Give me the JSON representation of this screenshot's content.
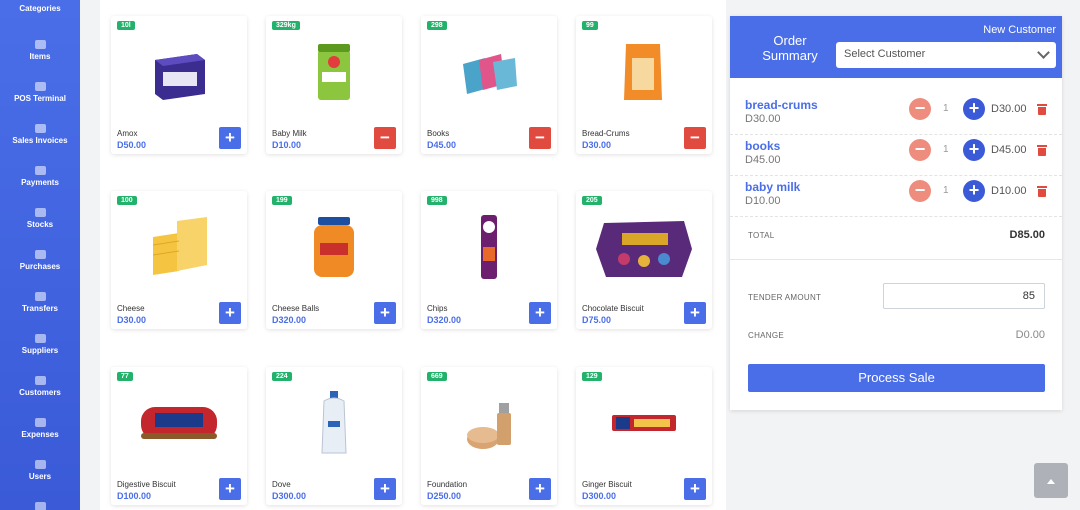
{
  "sidebar": {
    "items": [
      {
        "label": "Categories",
        "icon": "tag-icon"
      },
      {
        "label": "Items",
        "icon": "sitemap-icon"
      },
      {
        "label": "POS Terminal",
        "icon": "cash-register-icon"
      },
      {
        "label": "Sales Invoices",
        "icon": "file-icon"
      },
      {
        "label": "Payments",
        "icon": "money-icon"
      },
      {
        "label": "Stocks",
        "icon": "box-icon"
      },
      {
        "label": "Purchases",
        "icon": "cart-icon"
      },
      {
        "label": "Transfers",
        "icon": "truck-icon"
      },
      {
        "label": "Suppliers",
        "icon": "id-card-icon"
      },
      {
        "label": "Customers",
        "icon": "users-icon"
      },
      {
        "label": "Expenses",
        "icon": "wallet-icon"
      },
      {
        "label": "Users",
        "icon": "user-group-icon"
      }
    ]
  },
  "products": [
    {
      "stock": "10l",
      "name": "Amox",
      "price": "D50.00",
      "action": "add"
    },
    {
      "stock": "329kg",
      "name": "Baby Milk",
      "price": "D10.00",
      "action": "remove"
    },
    {
      "stock": "298",
      "name": "Books",
      "price": "D45.00",
      "action": "remove"
    },
    {
      "stock": "99",
      "name": "Bread-Crums",
      "price": "D30.00",
      "action": "remove"
    },
    {
      "stock": "100",
      "name": "Cheese",
      "price": "D30.00",
      "action": "add"
    },
    {
      "stock": "199",
      "name": "Cheese Balls",
      "price": "D320.00",
      "action": "add"
    },
    {
      "stock": "998",
      "name": "Chips",
      "price": "D320.00",
      "action": "add"
    },
    {
      "stock": "205",
      "name": "Chocolate Biscuit",
      "price": "D75.00",
      "action": "add"
    },
    {
      "stock": "77",
      "name": "Digestive Biscuit",
      "price": "D100.00",
      "action": "add"
    },
    {
      "stock": "224",
      "name": "Dove",
      "price": "D300.00",
      "action": "add"
    },
    {
      "stock": "669",
      "name": "Foundation",
      "price": "D250.00",
      "action": "add"
    },
    {
      "stock": "129",
      "name": "Ginger Biscuit",
      "price": "D300.00",
      "action": "add"
    }
  ],
  "order": {
    "title": "Order Summary",
    "new_customer": "New Customer",
    "customer_select": "Select Customer",
    "lines": [
      {
        "name": "bread-crums",
        "unit_price": "D30.00",
        "qty": "1",
        "total": "D30.00"
      },
      {
        "name": "books",
        "unit_price": "D45.00",
        "qty": "1",
        "total": "D45.00"
      },
      {
        "name": "baby milk",
        "unit_price": "D10.00",
        "qty": "1",
        "total": "D10.00"
      }
    ],
    "total_label": "TOTAL",
    "total_value": "D85.00",
    "tender_label": "TENDER AMOUNT",
    "tender_value": "85",
    "change_label": "CHANGE",
    "change_value": "D0.00",
    "process_label": "Process Sale"
  },
  "colors": {
    "primary": "#4a6ee8",
    "danger": "#e04a3f",
    "stock_badge": "#22b26b"
  }
}
